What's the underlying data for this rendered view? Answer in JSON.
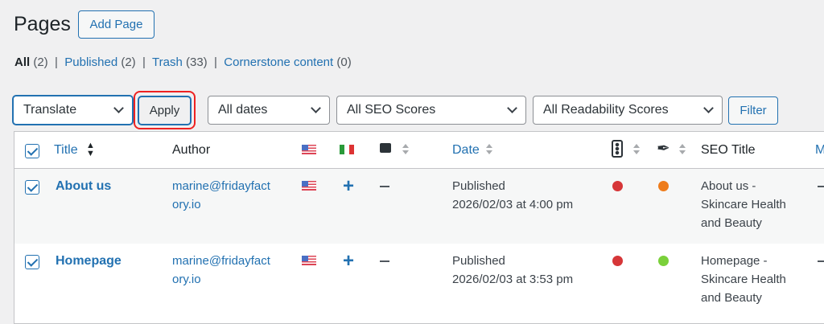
{
  "page_title": "Pages",
  "add_page_label": "Add Page",
  "filters_links": [
    {
      "label": "All",
      "count": "(2)"
    },
    {
      "label": "Published",
      "count": "(2)"
    },
    {
      "label": "Trash",
      "count": "(33)"
    },
    {
      "label": "Cornerstone content",
      "count": "(0)"
    }
  ],
  "separator": "|",
  "bulk_action": {
    "value": "Translate",
    "apply_label": "Apply"
  },
  "filters": {
    "dates": "All dates",
    "seo": "All SEO Scores",
    "readability": "All Readability Scores",
    "filter_label": "Filter"
  },
  "columns": {
    "title": "Title",
    "author": "Author",
    "date": "Date",
    "seo_title": "SEO Title",
    "more": "M"
  },
  "rows": [
    {
      "title": "About us",
      "author_1": "marine@fridayfact",
      "author_2": "ory.io",
      "status": "Published",
      "date": "2026/02/03 at 4:00 pm",
      "seo_score_color": "#d63638",
      "readability_color": "#ee7c1b",
      "seo_title_1": "About us -",
      "seo_title_2": "Skincare Health",
      "seo_title_3": "and Beauty",
      "selected": true
    },
    {
      "title": "Homepage",
      "author_1": "marine@fridayfact",
      "author_2": "ory.io",
      "status": "Published",
      "date": "2026/02/03 at 3:53 pm",
      "seo_score_color": "#d63638",
      "readability_color": "#7ad03a",
      "seo_title_1": "Homepage -",
      "seo_title_2": "Skincare Health",
      "seo_title_3": "and Beauty",
      "selected": true
    }
  ],
  "colors": {
    "accent": "#2271b1",
    "highlight": "#d63638"
  }
}
